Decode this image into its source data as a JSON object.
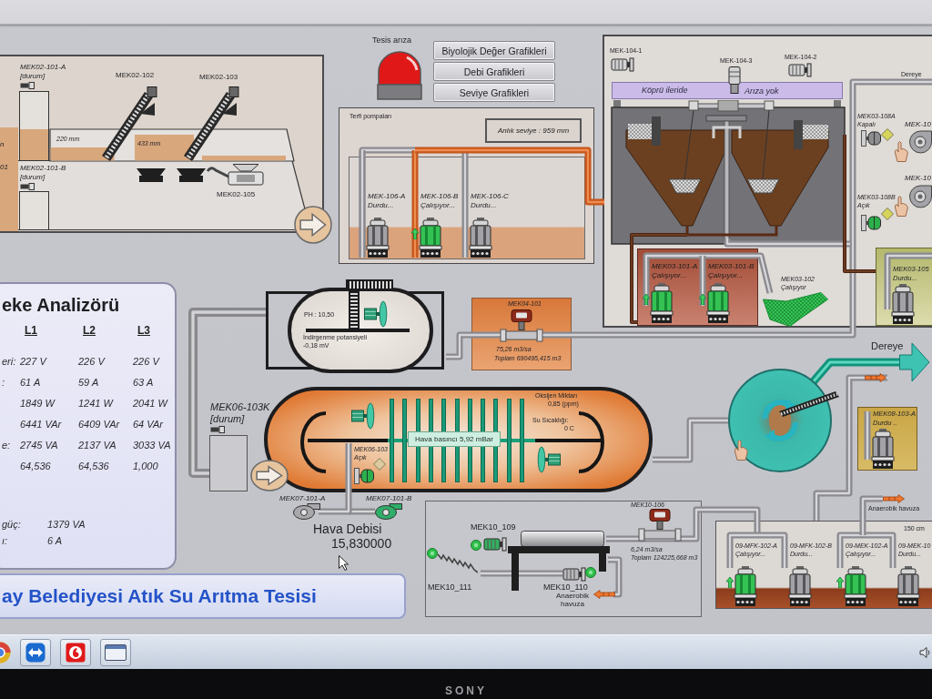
{
  "header": {
    "alarm": {
      "label": "Tesis arıza",
      "active": true
    },
    "chart_buttons": [
      {
        "label": "Biyolojik Değer Grafikleri"
      },
      {
        "label": "Debi Grafikleri"
      },
      {
        "label": "Seviye Grafikleri"
      }
    ]
  },
  "screening": {
    "edge_labels": [
      "n",
      "01"
    ],
    "screens": [
      {
        "tag": "MEK02-101-A",
        "status": "[durum]"
      },
      {
        "tag": "MEK02-101-B",
        "status": "[durum]"
      }
    ],
    "conveyors": [
      "MEK02-102",
      "MEK02-103"
    ],
    "levels": [
      "220 mm",
      "433 mm"
    ],
    "compactor": "MEK02-105"
  },
  "lift_station": {
    "title": "Terfi pompaları",
    "level_reading": "Anlık seviye : 959 mm",
    "pumps": [
      {
        "tag": "MEK-106-A",
        "status": "Durdu...",
        "running": false
      },
      {
        "tag": "MEK-106-B",
        "status": "Çalışıyor...",
        "running": true
      },
      {
        "tag": "MEK-106-C",
        "status": "Durdu...",
        "running": false
      }
    ]
  },
  "clarifier": {
    "drives": [
      "MEK-104-1",
      "MEK-104-3",
      "MEK-104-2"
    ],
    "bridge_position": "Köprü ileride",
    "bridge_fault": "Arıza yok",
    "outlet_label": "Dereye",
    "valves": [
      {
        "tag": "MEK03-108A",
        "status": "Kapalı",
        "open": false
      },
      {
        "tag": "MEK03-108B",
        "status": "Açık",
        "open": true
      }
    ],
    "blowers": [
      "MEK-10",
      "MEK-10"
    ],
    "sludge_pumps": [
      {
        "tag": "MEK03-101-A",
        "status": "Çalışıyor...",
        "running": true
      },
      {
        "tag": "MEK03-101-B",
        "status": "Çalışıyor...",
        "running": true
      }
    ],
    "screw": {
      "tag": "MEK03-102",
      "status": "Çalışıyor",
      "running": true
    },
    "scum_pump": {
      "tag": "MEK03-105",
      "status": "Durdu...",
      "running": false
    }
  },
  "analyzer": {
    "title": "eke Analizörü",
    "phases": [
      "L1",
      "L2",
      "L3"
    ],
    "rows": [
      {
        "label": "eri:",
        "values": [
          "227 V",
          "226 V",
          "226 V"
        ]
      },
      {
        "label": ":",
        "values": [
          "61 A",
          "59 A",
          "63 A"
        ]
      },
      {
        "values": [
          "1849 W",
          "1241 W",
          "2041 W"
        ]
      },
      {
        "values": [
          "6441 VAr",
          "6409 VAr",
          "64 VAr"
        ]
      },
      {
        "label": "e:",
        "values": [
          "2745 VA",
          "2137 VA",
          "3033 VA"
        ]
      },
      {
        "values": [
          "64,536",
          "64,536",
          "1,000"
        ]
      }
    ],
    "totals": [
      {
        "label": "güç:",
        "value": "1379 VA"
      },
      {
        "label": "ı:",
        "value": "6 A"
      }
    ]
  },
  "banner": {
    "title": "ay Belediyesi Atık Su Arıtma Tesisi"
  },
  "anoxic_tank": {
    "ph": "PH : 10,50",
    "orp_label": "İndirgenme potansiyeli",
    "orp_value": "-0,18 mV"
  },
  "flow_meter": {
    "tag": "MEK04-101",
    "flow": "75,26 m3/sa",
    "total": "Toplam 690495,415 m3"
  },
  "aeration": {
    "control": {
      "tag": "MEK06-103K",
      "status": "[durum]"
    },
    "oxygen_label": "Oksijen Miktarı",
    "oxygen_value": "0,85 (ppm)",
    "temp_label": "Su Sıcaklığı:",
    "temp_value": "0 C",
    "air_pressure": "Hava basıncı 5,92 mBar",
    "valve": {
      "tag": "MEK06-103",
      "status": "Açık",
      "open": true
    }
  },
  "air_blowers": {
    "units": [
      {
        "tag": "MEK07-101-A",
        "running": false
      },
      {
        "tag": "MEK07-101-B",
        "running": true
      }
    ],
    "flow_label": "Hava Debisi",
    "flow_value": "15,830000"
  },
  "sludge_press": {
    "meter_tag": "MEK10-106",
    "press_tag": "MEK10_109",
    "flow": "6,24 m3/sa",
    "total": "Toplam 124225,668 m3",
    "conveyor_tag": "MEK10_111",
    "pump_tag": "MEK10_110",
    "outlet_label": "Anaerobik havuza"
  },
  "drum_screen": {
    "outlet_label": "Dereye",
    "pump": {
      "tag": "MEK08-103-A",
      "status": "Durdu ..",
      "running": false
    }
  },
  "pump_station": {
    "outlet_label": "Anaerobik havuza",
    "level_reading": "150 cm",
    "pumps": [
      {
        "tag": "09-MFK-102-A",
        "status": "Çalışıyor...",
        "running": true
      },
      {
        "tag": "09-MFK-102-B",
        "status": "Durdu...",
        "running": false
      },
      {
        "tag": "09-MEK-102-A",
        "status": "Çalışıyor...",
        "running": true
      },
      {
        "tag": "09-MEK-10",
        "status": "Durdu...",
        "running": false
      }
    ]
  },
  "bezel": {
    "brand": "SONY"
  }
}
